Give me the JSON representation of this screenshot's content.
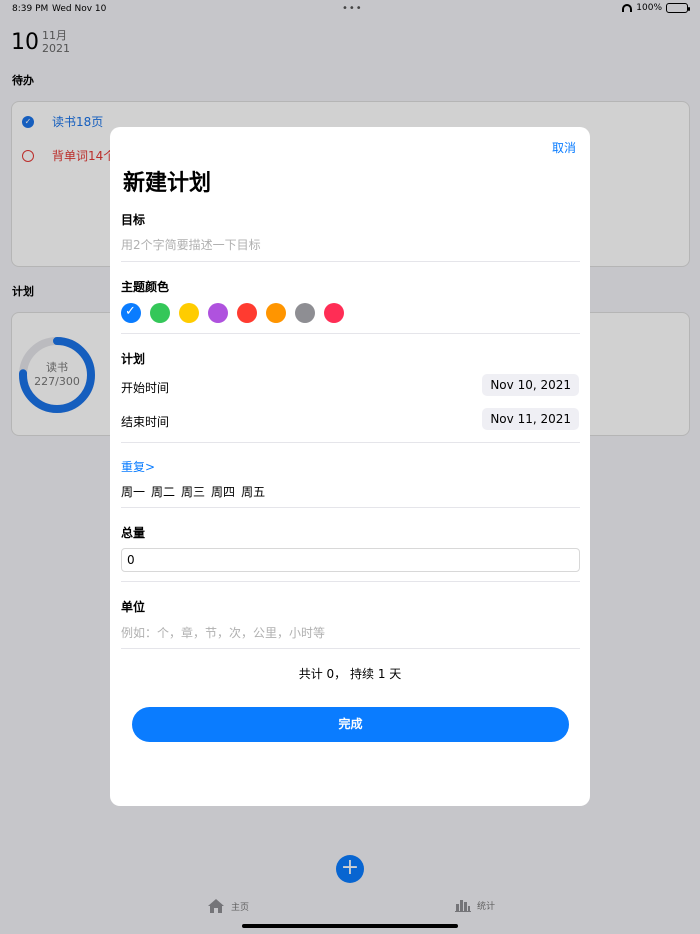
{
  "status_bar": {
    "time": "8:39 PM",
    "date": "Wed Nov 10",
    "battery": "100%",
    "battery_level": 1.0
  },
  "header": {
    "day": "10",
    "month": "11月",
    "year": "2021"
  },
  "todo_section": {
    "title": "待办",
    "items": [
      {
        "label": "读书18页",
        "done": true,
        "color": "#1a73e8"
      },
      {
        "label": "背单词14个",
        "done": false,
        "color": "#e53935"
      }
    ]
  },
  "plan_section": {
    "title": "计划",
    "ring": {
      "name": "读书",
      "progress_text": "227/300",
      "progress": 0.757,
      "color": "#1a73e8"
    }
  },
  "modal": {
    "cancel": "取消",
    "title": "新建计划",
    "goal": {
      "label": "目标",
      "placeholder": "用2个字简要描述一下目标"
    },
    "theme_color": {
      "label": "主题颜色",
      "swatches": [
        "#0a7cff",
        "#34c759",
        "#ffcc00",
        "#af52de",
        "#ff3b30",
        "#ff9500",
        "#8e8e93",
        "#ff2d55"
      ],
      "selected_index": 0
    },
    "plan": {
      "label": "计划",
      "start_label": "开始时间",
      "start_value": "Nov 10, 2021",
      "end_label": "结束时间",
      "end_value": "Nov 11, 2021"
    },
    "repeat": {
      "label": "重复>",
      "days": [
        "周一",
        "周二",
        "周三",
        "周四",
        "周五"
      ]
    },
    "total": {
      "label": "总量",
      "value": "0"
    },
    "unit": {
      "label": "单位",
      "placeholder": "例如：个，章，节，次，公里，小时等"
    },
    "summary": "共计 0， 持续 1 天",
    "done_button": "完成"
  },
  "tab_bar": {
    "home_label": "主页",
    "stats_label": "统计"
  }
}
